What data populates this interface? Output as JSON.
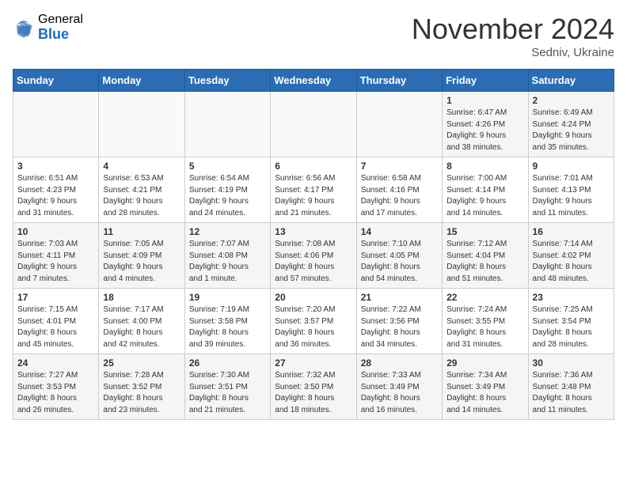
{
  "logo": {
    "general": "General",
    "blue": "Blue"
  },
  "title": "November 2024",
  "location": "Sedniv, Ukraine",
  "days_of_week": [
    "Sunday",
    "Monday",
    "Tuesday",
    "Wednesday",
    "Thursday",
    "Friday",
    "Saturday"
  ],
  "weeks": [
    [
      {
        "day": "",
        "info": ""
      },
      {
        "day": "",
        "info": ""
      },
      {
        "day": "",
        "info": ""
      },
      {
        "day": "",
        "info": ""
      },
      {
        "day": "",
        "info": ""
      },
      {
        "day": "1",
        "info": "Sunrise: 6:47 AM\nSunset: 4:26 PM\nDaylight: 9 hours\nand 38 minutes."
      },
      {
        "day": "2",
        "info": "Sunrise: 6:49 AM\nSunset: 4:24 PM\nDaylight: 9 hours\nand 35 minutes."
      }
    ],
    [
      {
        "day": "3",
        "info": "Sunrise: 6:51 AM\nSunset: 4:23 PM\nDaylight: 9 hours\nand 31 minutes."
      },
      {
        "day": "4",
        "info": "Sunrise: 6:53 AM\nSunset: 4:21 PM\nDaylight: 9 hours\nand 28 minutes."
      },
      {
        "day": "5",
        "info": "Sunrise: 6:54 AM\nSunset: 4:19 PM\nDaylight: 9 hours\nand 24 minutes."
      },
      {
        "day": "6",
        "info": "Sunrise: 6:56 AM\nSunset: 4:17 PM\nDaylight: 9 hours\nand 21 minutes."
      },
      {
        "day": "7",
        "info": "Sunrise: 6:58 AM\nSunset: 4:16 PM\nDaylight: 9 hours\nand 17 minutes."
      },
      {
        "day": "8",
        "info": "Sunrise: 7:00 AM\nSunset: 4:14 PM\nDaylight: 9 hours\nand 14 minutes."
      },
      {
        "day": "9",
        "info": "Sunrise: 7:01 AM\nSunset: 4:13 PM\nDaylight: 9 hours\nand 11 minutes."
      }
    ],
    [
      {
        "day": "10",
        "info": "Sunrise: 7:03 AM\nSunset: 4:11 PM\nDaylight: 9 hours\nand 7 minutes."
      },
      {
        "day": "11",
        "info": "Sunrise: 7:05 AM\nSunset: 4:09 PM\nDaylight: 9 hours\nand 4 minutes."
      },
      {
        "day": "12",
        "info": "Sunrise: 7:07 AM\nSunset: 4:08 PM\nDaylight: 9 hours\nand 1 minute."
      },
      {
        "day": "13",
        "info": "Sunrise: 7:08 AM\nSunset: 4:06 PM\nDaylight: 8 hours\nand 57 minutes."
      },
      {
        "day": "14",
        "info": "Sunrise: 7:10 AM\nSunset: 4:05 PM\nDaylight: 8 hours\nand 54 minutes."
      },
      {
        "day": "15",
        "info": "Sunrise: 7:12 AM\nSunset: 4:04 PM\nDaylight: 8 hours\nand 51 minutes."
      },
      {
        "day": "16",
        "info": "Sunrise: 7:14 AM\nSunset: 4:02 PM\nDaylight: 8 hours\nand 48 minutes."
      }
    ],
    [
      {
        "day": "17",
        "info": "Sunrise: 7:15 AM\nSunset: 4:01 PM\nDaylight: 8 hours\nand 45 minutes."
      },
      {
        "day": "18",
        "info": "Sunrise: 7:17 AM\nSunset: 4:00 PM\nDaylight: 8 hours\nand 42 minutes."
      },
      {
        "day": "19",
        "info": "Sunrise: 7:19 AM\nSunset: 3:58 PM\nDaylight: 8 hours\nand 39 minutes."
      },
      {
        "day": "20",
        "info": "Sunrise: 7:20 AM\nSunset: 3:57 PM\nDaylight: 8 hours\nand 36 minutes."
      },
      {
        "day": "21",
        "info": "Sunrise: 7:22 AM\nSunset: 3:56 PM\nDaylight: 8 hours\nand 34 minutes."
      },
      {
        "day": "22",
        "info": "Sunrise: 7:24 AM\nSunset: 3:55 PM\nDaylight: 8 hours\nand 31 minutes."
      },
      {
        "day": "23",
        "info": "Sunrise: 7:25 AM\nSunset: 3:54 PM\nDaylight: 8 hours\nand 28 minutes."
      }
    ],
    [
      {
        "day": "24",
        "info": "Sunrise: 7:27 AM\nSunset: 3:53 PM\nDaylight: 8 hours\nand 26 minutes."
      },
      {
        "day": "25",
        "info": "Sunrise: 7:28 AM\nSunset: 3:52 PM\nDaylight: 8 hours\nand 23 minutes."
      },
      {
        "day": "26",
        "info": "Sunrise: 7:30 AM\nSunset: 3:51 PM\nDaylight: 8 hours\nand 21 minutes."
      },
      {
        "day": "27",
        "info": "Sunrise: 7:32 AM\nSunset: 3:50 PM\nDaylight: 8 hours\nand 18 minutes."
      },
      {
        "day": "28",
        "info": "Sunrise: 7:33 AM\nSunset: 3:49 PM\nDaylight: 8 hours\nand 16 minutes."
      },
      {
        "day": "29",
        "info": "Sunrise: 7:34 AM\nSunset: 3:49 PM\nDaylight: 8 hours\nand 14 minutes."
      },
      {
        "day": "30",
        "info": "Sunrise: 7:36 AM\nSunset: 3:48 PM\nDaylight: 8 hours\nand 11 minutes."
      }
    ]
  ]
}
